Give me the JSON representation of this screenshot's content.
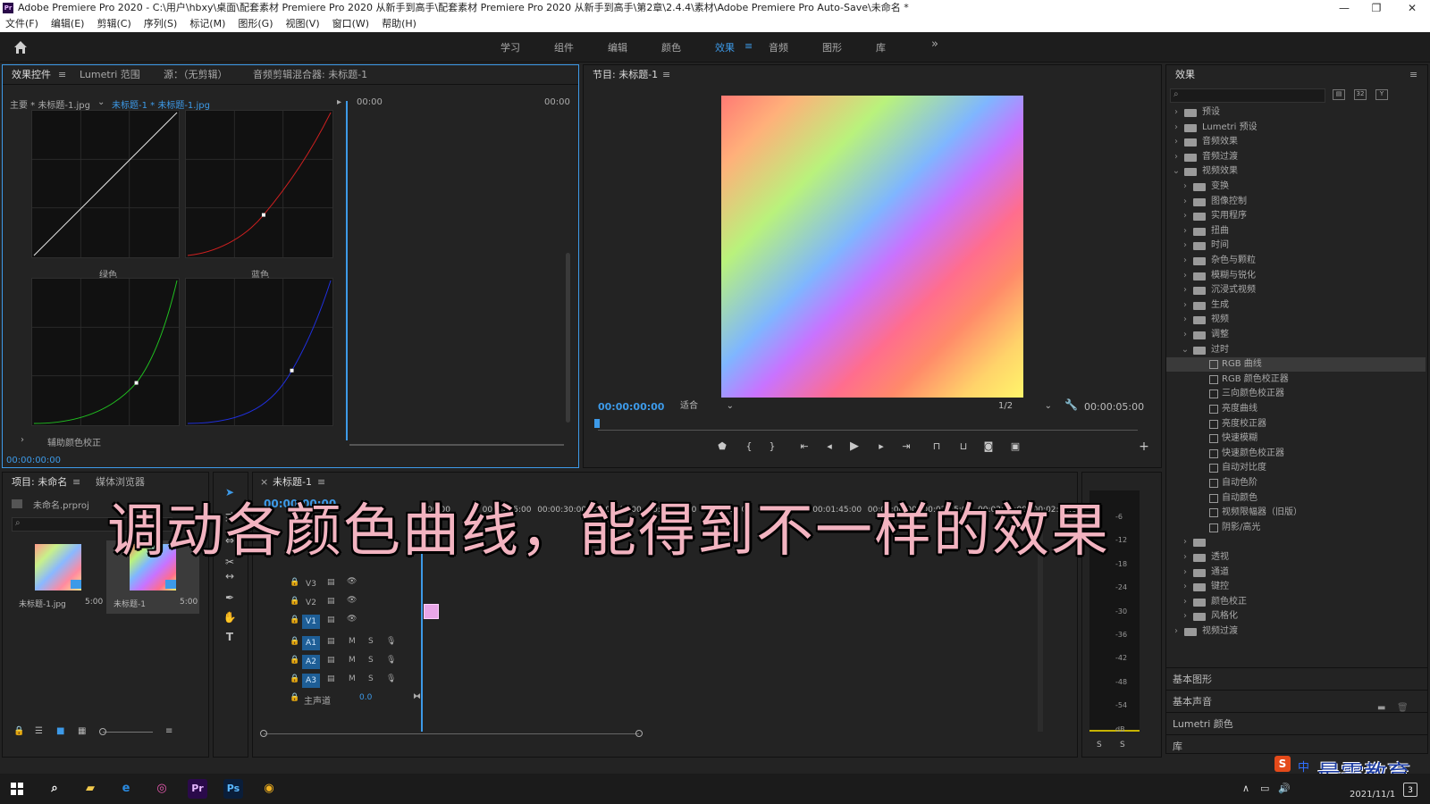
{
  "window": {
    "title": "Adobe Premiere Pro 2020 - C:\\用户\\hbxy\\桌面\\配套素材 Premiere Pro 2020 从新手到高手\\配套素材 Premiere Pro 2020 从新手到高手\\第2章\\2.4.4\\素材\\Adobe Premiere Pro Auto-Save\\未命名 *",
    "logo": "Pr"
  },
  "menu": [
    "文件(F)",
    "编辑(E)",
    "剪辑(C)",
    "序列(S)",
    "标记(M)",
    "图形(G)",
    "视图(V)",
    "窗口(W)",
    "帮助(H)"
  ],
  "workspaces": [
    "学习",
    "组件",
    "编辑",
    "颜色",
    "效果",
    "音频",
    "图形",
    "库"
  ],
  "active_workspace": "效果",
  "more_icon": "»",
  "effect_controls": {
    "tabs": [
      "效果控件",
      "Lumetri 范围",
      "源：（无剪辑）",
      "音频剪辑混合器: 未标题-1"
    ],
    "master_label": "主要 * 未标题-1.jpg",
    "clip_label": "未标题-1 * 未标题-1.jpg",
    "tc_left": "00:00",
    "tc_right": "00:00",
    "green_label": "绿色",
    "blue_label": "蓝色",
    "aux_label": "辅助颜色校正",
    "bottom_tc": "00:00:00:00"
  },
  "program": {
    "title": "节目: 未标题-1",
    "timecode": "00:00:00:00",
    "fit": "适合",
    "resolution": "1/2",
    "duration": "00:00:05:00"
  },
  "effects": {
    "title": "效果",
    "tree": [
      {
        "label": "预设",
        "level": 0,
        "type": "folder",
        "open": false
      },
      {
        "label": "Lumetri 预设",
        "level": 0,
        "type": "folder",
        "open": false
      },
      {
        "label": "音频效果",
        "level": 0,
        "type": "folder",
        "open": false
      },
      {
        "label": "音频过渡",
        "level": 0,
        "type": "folder",
        "open": false
      },
      {
        "label": "视频效果",
        "level": 0,
        "type": "folder",
        "open": true
      },
      {
        "label": "变换",
        "level": 1,
        "type": "folder",
        "open": false
      },
      {
        "label": "图像控制",
        "level": 1,
        "type": "folder",
        "open": false
      },
      {
        "label": "实用程序",
        "level": 1,
        "type": "folder",
        "open": false
      },
      {
        "label": "扭曲",
        "level": 1,
        "type": "folder",
        "open": false
      },
      {
        "label": "时间",
        "level": 1,
        "type": "folder",
        "open": false
      },
      {
        "label": "杂色与颗粒",
        "level": 1,
        "type": "folder",
        "open": false
      },
      {
        "label": "模糊与锐化",
        "level": 1,
        "type": "folder",
        "open": false
      },
      {
        "label": "沉浸式视频",
        "level": 1,
        "type": "folder",
        "open": false
      },
      {
        "label": "生成",
        "level": 1,
        "type": "folder",
        "open": false
      },
      {
        "label": "视频",
        "level": 1,
        "type": "folder",
        "open": false
      },
      {
        "label": "调整",
        "level": 1,
        "type": "folder",
        "open": false
      },
      {
        "label": "过时",
        "level": 1,
        "type": "folder",
        "open": true
      },
      {
        "label": "RGB 曲线",
        "level": 2,
        "type": "effect",
        "selected": true
      },
      {
        "label": "RGB 颜色校正器",
        "level": 2,
        "type": "effect"
      },
      {
        "label": "三向颜色校正器",
        "level": 2,
        "type": "effect"
      },
      {
        "label": "亮度曲线",
        "level": 2,
        "type": "effect"
      },
      {
        "label": "亮度校正器",
        "level": 2,
        "type": "effect"
      },
      {
        "label": "快速模糊",
        "level": 2,
        "type": "effect"
      },
      {
        "label": "快速颜色校正器",
        "level": 2,
        "type": "effect"
      },
      {
        "label": "自动对比度",
        "level": 2,
        "type": "effect"
      },
      {
        "label": "自动色阶",
        "level": 2,
        "type": "effect"
      },
      {
        "label": "自动颜色",
        "level": 2,
        "type": "effect"
      },
      {
        "label": "视频限幅器（旧版）",
        "level": 2,
        "type": "effect"
      },
      {
        "label": "阴影/高光",
        "level": 2,
        "type": "effect"
      },
      {
        "label": "",
        "level": 1,
        "type": "folder",
        "open": false
      },
      {
        "label": "透视",
        "level": 1,
        "type": "folder",
        "open": false
      },
      {
        "label": "通道",
        "level": 1,
        "type": "folder",
        "open": false
      },
      {
        "label": "键控",
        "level": 1,
        "type": "folder",
        "open": false
      },
      {
        "label": "颜色校正",
        "level": 1,
        "type": "folder",
        "open": false
      },
      {
        "label": "风格化",
        "level": 1,
        "type": "folder",
        "open": false
      },
      {
        "label": "视频过渡",
        "level": 0,
        "type": "folder",
        "open": false
      }
    ],
    "sections": [
      "基本图形",
      "基本声音",
      "Lumetri 颜色",
      "库"
    ]
  },
  "project": {
    "tabs": [
      "项目: 未命名",
      "媒体浏览器"
    ],
    "file": "未命名.prproj",
    "items": [
      {
        "name": "未标题-1.jpg",
        "dur": "5:00"
      },
      {
        "name": "未标题-1",
        "dur": "5:00"
      }
    ]
  },
  "timeline": {
    "tab": "未标题-1",
    "timecode": "00:00:00:00",
    "ruler": [
      "00:00",
      "00:00:15:00",
      "00:00:30:00",
      "00:00:45:00",
      "00:01:00:00",
      "00:01:15:00",
      "00:01:30:00",
      "00:01:45:00",
      "00:02:00:00",
      "00:02:15:00",
      "00:02:30:00",
      "00:02:45:00"
    ],
    "video_tracks": [
      "V3",
      "V2",
      "V1"
    ],
    "audio_tracks": [
      "A1",
      "A2",
      "A3"
    ],
    "mute": "M",
    "solo": "S",
    "master": "主声道",
    "master_val": "0.0"
  },
  "meter": {
    "labels": [
      "-6",
      "-12",
      "-18",
      "-24",
      "-30",
      "-36",
      "-42",
      "-48",
      "-54",
      "dB"
    ],
    "solo": [
      "S",
      "S"
    ]
  },
  "subtitle": "调动各颜色曲线，能得到不一样的效果",
  "watermark": "最需教育",
  "ime": "中",
  "taskbar": {
    "date": "2021/11/1",
    "apps": [
      "Pr",
      "Ps"
    ],
    "notify_count": "3"
  }
}
